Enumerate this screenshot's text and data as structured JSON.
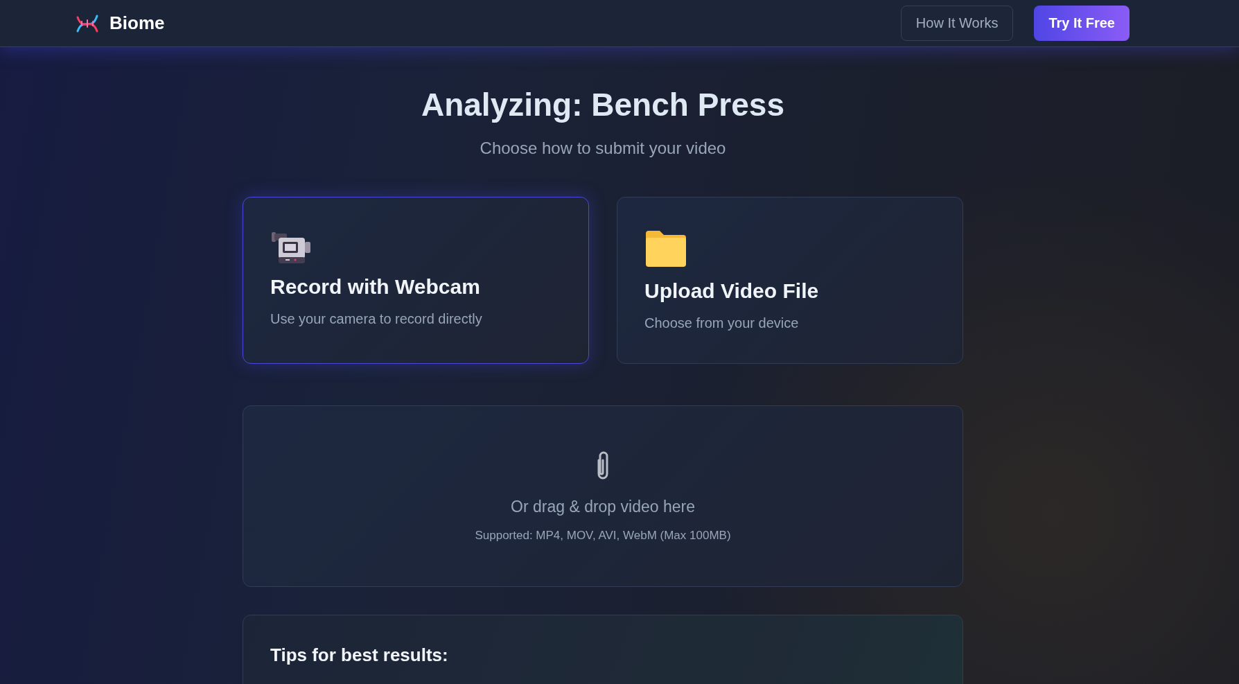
{
  "header": {
    "brand": "Biome",
    "nav": [
      {
        "label": "How It Works",
        "kind": "outline"
      },
      {
        "label": "Try It Free",
        "kind": "primary"
      }
    ]
  },
  "title": "Analyzing: Bench Press",
  "subtitle": "Choose how to submit your video",
  "options": [
    {
      "kind": "camera",
      "title": "Record with Webcam",
      "description": "Use your camera to record directly",
      "selected": true
    },
    {
      "kind": "folder",
      "title": "Upload Video File",
      "description": "Choose from your device",
      "selected": false
    }
  ],
  "dropzone": {
    "text": "Or drag & drop video here",
    "hint": "Supported: MP4, MOV, AVI, WebM (Max 100MB)"
  },
  "tips": {
    "title": "Tips for best results:"
  }
}
